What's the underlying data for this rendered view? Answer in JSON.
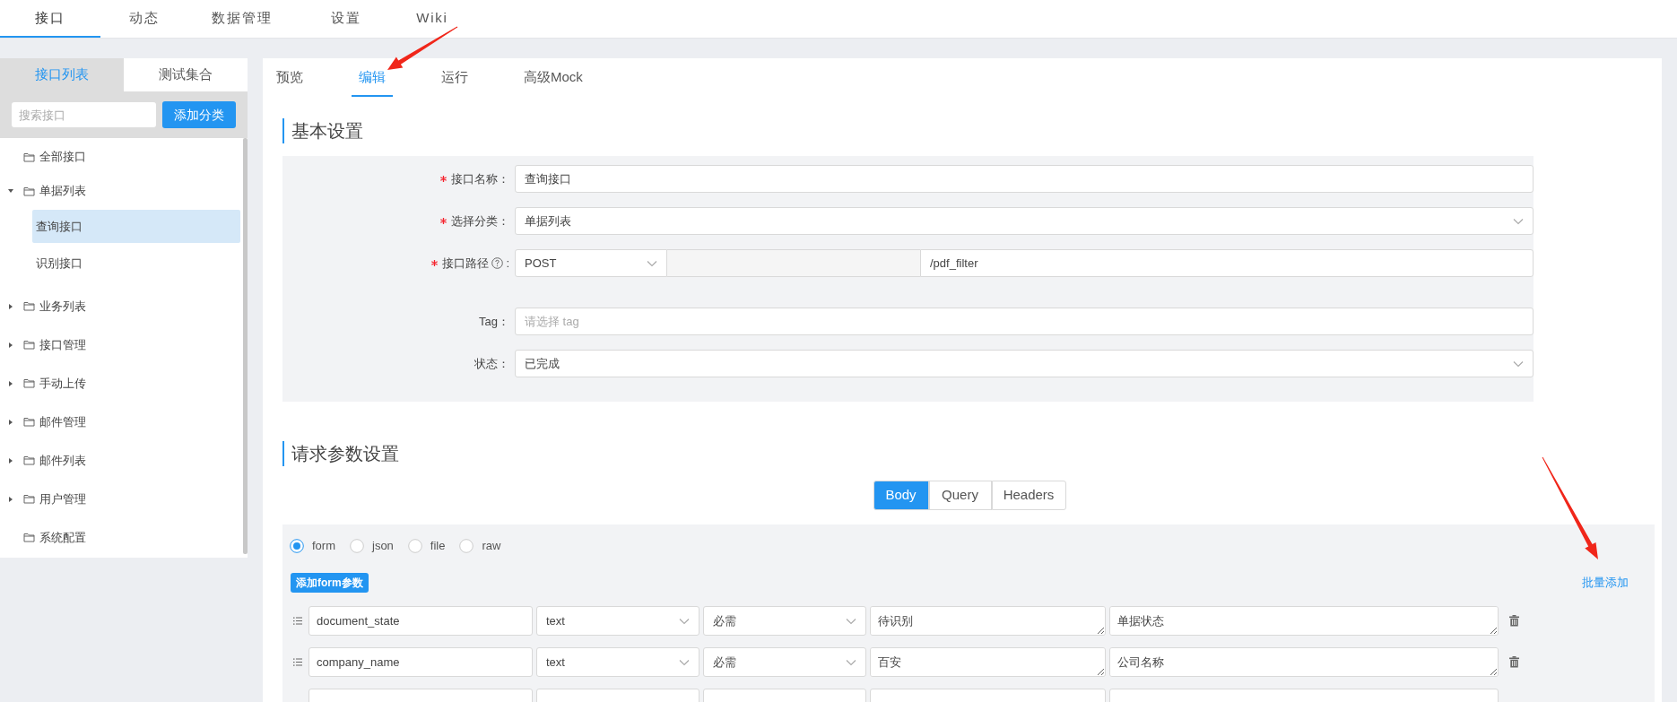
{
  "nav": [
    {
      "label": "接口",
      "selected": true
    },
    {
      "label": "动态",
      "selected": false
    },
    {
      "label": "数据管理",
      "selected": false
    },
    {
      "label": "设置",
      "selected": false
    },
    {
      "label": "Wiki",
      "selected": false
    }
  ],
  "sidebar": {
    "tabs": [
      {
        "label": "接口列表",
        "selected": true
      },
      {
        "label": "测试集合",
        "selected": false
      }
    ],
    "search": {
      "placeholder": "搜索接口"
    },
    "add_button": "添加分类",
    "tree": [
      {
        "label": "全部接口",
        "selected": false
      },
      {
        "label": "单据列表",
        "selected": false,
        "expanded": true,
        "children": [
          {
            "label": "查询接口",
            "selected": true
          },
          {
            "label": "识别接口",
            "selected": false
          }
        ]
      },
      {
        "label": "业务列表",
        "selected": false,
        "expanded": false
      },
      {
        "label": "接口管理",
        "selected": false,
        "expanded": false
      },
      {
        "label": "手动上传",
        "selected": false,
        "expanded": false
      },
      {
        "label": "邮件管理",
        "selected": false,
        "expanded": false
      },
      {
        "label": "邮件列表",
        "selected": false,
        "expanded": false
      },
      {
        "label": "用户管理",
        "selected": false,
        "expanded": false
      },
      {
        "label": "系统配置",
        "selected": false
      }
    ]
  },
  "tabs": [
    {
      "label": "预览",
      "selected": false
    },
    {
      "label": "编辑",
      "selected": true
    },
    {
      "label": "运行",
      "selected": false
    },
    {
      "label": "高级Mock",
      "selected": false
    }
  ],
  "basic_settings": {
    "title": "基本设置",
    "fields": [
      {
        "kind": "input",
        "label": "接口名称：",
        "required": true,
        "value": "查询接口"
      },
      {
        "kind": "select",
        "label": "选择分类：",
        "required": true,
        "value": "单据列表"
      },
      {
        "kind": "path",
        "label": "接口路径",
        "help": true,
        "suffix": ":",
        "required": true,
        "method": "POST",
        "value": "/pdf_filter"
      },
      {
        "kind": "input",
        "label": "Tag：",
        "required": false,
        "placeholder": "请选择 tag"
      },
      {
        "kind": "select",
        "label": "状态：",
        "required": false,
        "value": "已完成"
      }
    ]
  },
  "request_params": {
    "title": "请求参数设置",
    "tabs": [
      {
        "label": "Body",
        "selected": true
      },
      {
        "label": "Query",
        "selected": false
      },
      {
        "label": "Headers",
        "selected": false
      }
    ],
    "body_types": [
      {
        "label": "form",
        "selected": true
      },
      {
        "label": "json",
        "selected": false
      },
      {
        "label": "file",
        "selected": false
      },
      {
        "label": "raw",
        "selected": false
      }
    ],
    "add_button": "添加form参数",
    "bulk_add_link": "批量添加",
    "rows": [
      {
        "kind": "param",
        "name": "document_state",
        "type": "text",
        "required": "必需",
        "example": "待识别",
        "description": "单据状态"
      },
      {
        "kind": "param",
        "name": "company_name",
        "type": "text",
        "required": "必需",
        "example": "百安",
        "description": "公司名称"
      },
      {
        "kind": "cut_off"
      }
    ]
  }
}
